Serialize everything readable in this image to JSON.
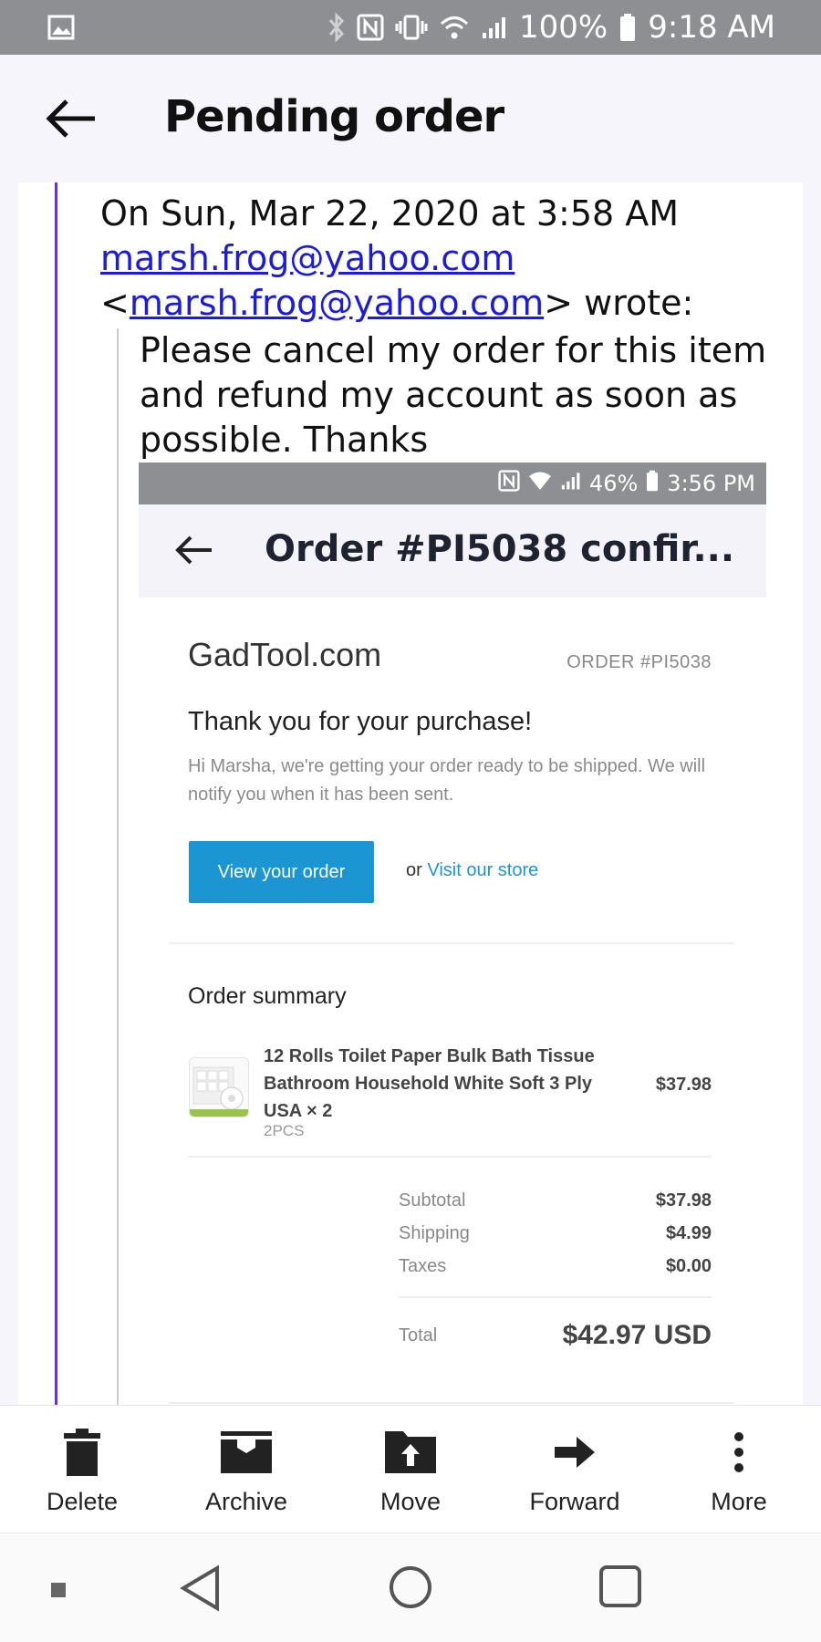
{
  "status_bar": {
    "battery": "100%",
    "time": "9:18 AM"
  },
  "header": {
    "title": "Pending order"
  },
  "email": {
    "date_line": "On Sun, Mar 22, 2020 at 3:58 AM",
    "sender_email": "marsh.frog@yahoo.com",
    "wrote_prefix": "<",
    "wrote_suffix": "> wrote:",
    "message": "Please cancel my order for this item and refund my account as soon as possible. Thanks"
  },
  "embedded": {
    "status_battery": "46%",
    "status_time": "3:56 PM",
    "title": "Order #PI5038 confir...",
    "store_name": "GadTool.com",
    "order_number": "ORDER #PI5038",
    "thanks": "Thank you for your purchase!",
    "hi_message": "Hi Marsha, we're getting your order ready to be shipped. We will notify you when it has been sent.",
    "view_button": "View your order",
    "or_text": "or",
    "visit_link": "Visit our store",
    "summary_title": "Order summary",
    "item": {
      "title": "12 Rolls Toilet Paper Bulk Bath Tissue Bathroom Household White Soft 3 Ply USA × 2",
      "variant": "2PCS",
      "price": "$37.98"
    },
    "totals": [
      {
        "label": "Subtotal",
        "value": "$37.98"
      },
      {
        "label": "Shipping",
        "value": "$4.99"
      },
      {
        "label": "Taxes",
        "value": "$0.00"
      }
    ],
    "total_label": "Total",
    "total_value": "$42.97 USD"
  },
  "toolbar": {
    "delete": "Delete",
    "archive": "Archive",
    "move": "Move",
    "forward": "Forward",
    "more": "More"
  },
  "colors": {
    "accent_purple": "#6a2fd0",
    "link_blue": "#1a1ae0",
    "store_blue": "#1b96d2",
    "status_gray": "#8e8f93"
  }
}
